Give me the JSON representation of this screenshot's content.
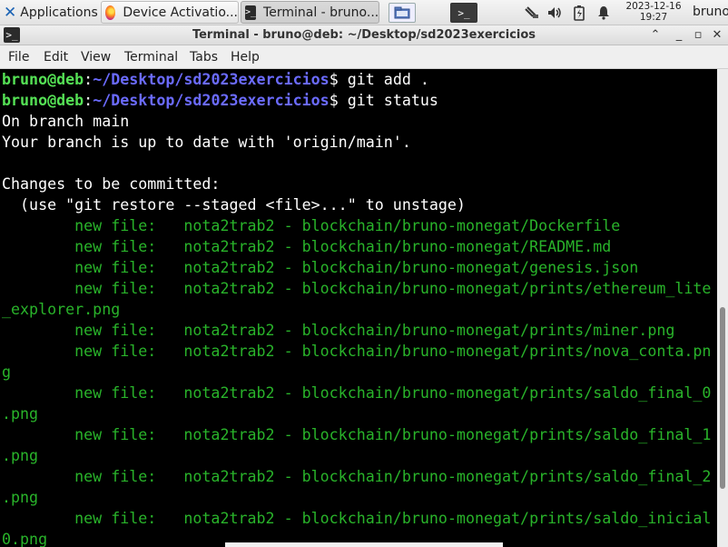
{
  "panel": {
    "applications_label": "Applications",
    "firefox_tab_label": "Device Activatio...",
    "terminal_tab_label": "Terminal - bruno...",
    "clock_date": "2023-12-16",
    "clock_time": "19:27",
    "user": "bruno"
  },
  "window": {
    "title": "Terminal - bruno@deb: ~/Desktop/sd2023exercicios",
    "menu": [
      "File",
      "Edit",
      "View",
      "Terminal",
      "Tabs",
      "Help"
    ]
  },
  "terminal": {
    "prompt_user": "bruno@deb",
    "prompt_path": "~/Desktop/sd2023exercicios",
    "commands": [
      "git add .",
      "git status"
    ],
    "output": [
      "On branch main",
      "Your branch is up to date with 'origin/main'.",
      "",
      "Changes to be committed:",
      "  (use \"git restore --staged <file>...\" to unstage)"
    ],
    "new_files": [
      "        new file:   nota2trab2 - blockchain/bruno-monegat/Dockerfile",
      "        new file:   nota2trab2 - blockchain/bruno-monegat/README.md",
      "        new file:   nota2trab2 - blockchain/bruno-monegat/genesis.json",
      "        new file:   nota2trab2 - blockchain/bruno-monegat/prints/ethereum_lite",
      "_explorer.png",
      "        new file:   nota2trab2 - blockchain/bruno-monegat/prints/miner.png",
      "        new file:   nota2trab2 - blockchain/bruno-monegat/prints/nova_conta.pn",
      "g",
      "        new file:   nota2trab2 - blockchain/bruno-monegat/prints/saldo_final_0",
      ".png",
      "        new file:   nota2trab2 - blockchain/bruno-monegat/prints/saldo_final_1",
      ".png",
      "        new file:   nota2trab2 - blockchain/bruno-monegat/prints/saldo_final_2",
      ".png",
      "        new file:   nota2trab2 - blockchain/bruno-monegat/prints/saldo_inicial",
      "0.png"
    ]
  }
}
